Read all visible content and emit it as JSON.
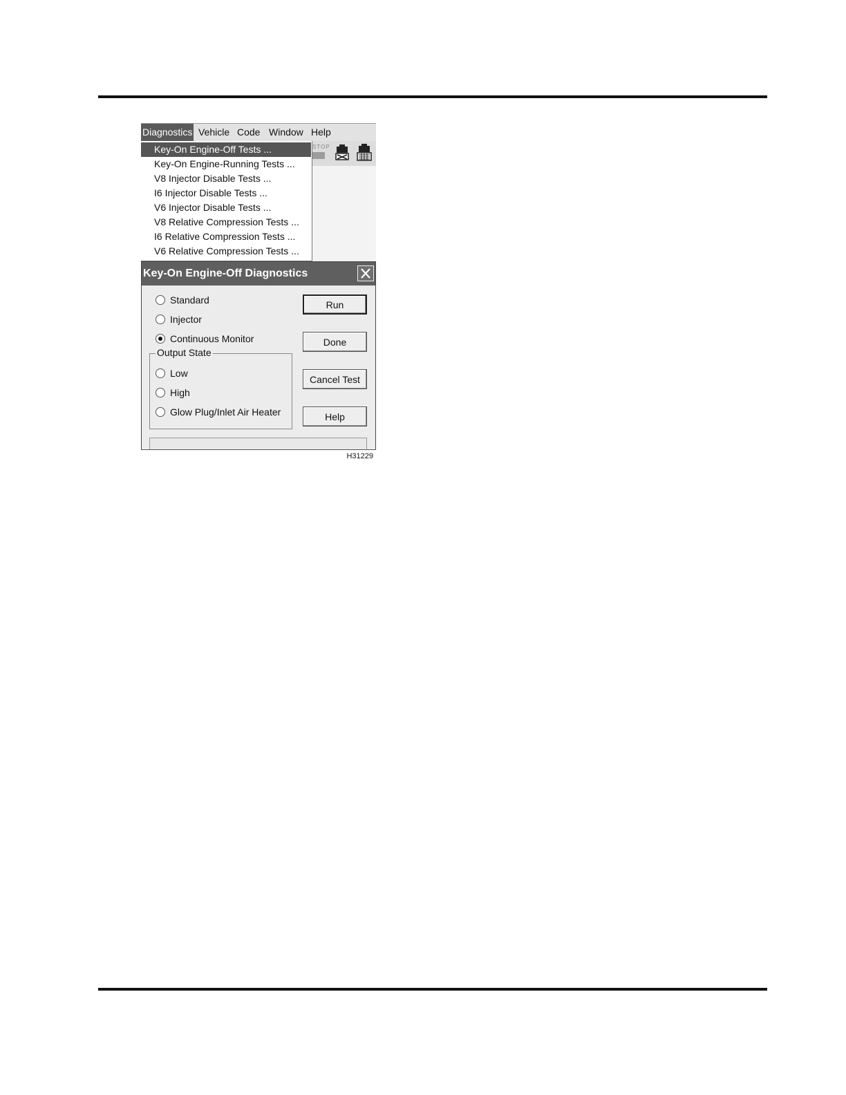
{
  "menubar": {
    "items": [
      "Diagnostics",
      "Vehicle",
      "Code",
      "Window",
      "Help"
    ],
    "active": "Diagnostics"
  },
  "toolbar": {
    "stop_label": "STOP"
  },
  "dropdown": {
    "items": [
      "Key-On Engine-Off Tests ...",
      "Key-On Engine-Running Tests ...",
      "V8 Injector Disable Tests ...",
      "I6 Injector Disable Tests ...",
      "V6 Injector Disable Tests ...",
      "V8 Relative Compression Tests ...",
      "I6 Relative Compression Tests ...",
      "V6 Relative Compression Tests ..."
    ],
    "highlighted": "Key-On Engine-Off Tests ..."
  },
  "dialog": {
    "title": "Key-On Engine-Off Diagnostics",
    "tests": {
      "options": [
        "Standard",
        "Injector",
        "Continuous Monitor"
      ],
      "selected": "Continuous Monitor"
    },
    "output_state": {
      "label": "Output State",
      "options": [
        "Low",
        "High",
        "Glow Plug/Inlet Air Heater"
      ],
      "selected": ""
    },
    "buttons": {
      "run": "Run",
      "done": "Done",
      "cancel_test": "Cancel Test",
      "help": "Help"
    }
  },
  "figure_id": "H31229",
  "colors": {
    "menu_highlight": "#5a5a5a",
    "titlebar": "#5f5f5f",
    "dialog_bg": "#ececec"
  },
  "icons": [
    "close-icon",
    "stop-icon",
    "engine-icon",
    "engine-keypad-icon"
  ]
}
